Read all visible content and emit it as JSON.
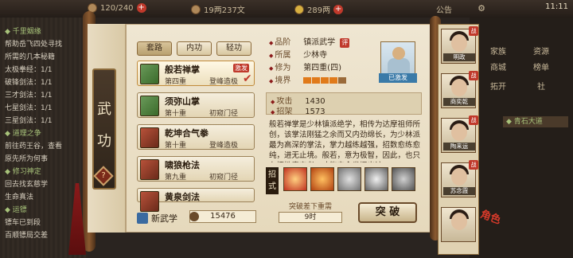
{
  "topbar": {
    "stamina": "120/240",
    "silver": "19两237文",
    "gold": "289两",
    "notice": "公告",
    "time": "11:11"
  },
  "left_quests": [
    {
      "text": "◆ 千里姻缘",
      "color": "green"
    },
    {
      "text": "帮助岳飞四处寻找",
      "color": "white"
    },
    {
      "text": "所需的几本秘籍",
      "color": "white"
    },
    {
      "text": "太极拳经：1/1",
      "color": "white"
    },
    {
      "text": "破锋剑法：1/1",
      "color": "white"
    },
    {
      "text": "三才剑法：1/1",
      "color": "white"
    },
    {
      "text": "七星剑法：1/1",
      "color": "white"
    },
    {
      "text": "三星剑法：1/1",
      "color": "white"
    },
    {
      "text": "◆ 道理之争",
      "color": "green"
    },
    {
      "text": "前往药王谷，查看",
      "color": "white"
    },
    {
      "text": "原先所为何事",
      "color": "white"
    },
    {
      "text": "◆ 修习神定",
      "color": "green"
    },
    {
      "text": "回去找玄慈学",
      "color": "white"
    },
    {
      "text": "生命真法",
      "color": "white"
    },
    {
      "text": "◆ 运镖",
      "color": "green"
    },
    {
      "text": "镖车已到段",
      "color": "white"
    },
    {
      "text": "百顺镖局交差",
      "color": "white"
    }
  ],
  "panel": {
    "title": "武功",
    "help": "?",
    "tabs": [
      "套路",
      "内功",
      "轻功"
    ],
    "skills": [
      {
        "name": "般若禅掌",
        "tier": "第四重",
        "level": "登峰造极",
        "book": "green",
        "badge": "激发",
        "selected": true
      },
      {
        "name": "须弥山掌",
        "tier": "第十重",
        "level": "初窥门径",
        "book": "green"
      },
      {
        "name": "乾坤合气拳",
        "tier": "第十重",
        "level": "登峰造极",
        "book": "red"
      },
      {
        "name": "啸狼枪法",
        "tier": "第九重",
        "level": "初窥门径",
        "book": "red"
      },
      {
        "name": "黄泉剑法",
        "tier": "",
        "level": "",
        "book": "red"
      }
    ],
    "new_skill_label": "新武学",
    "points": "15476"
  },
  "detail": {
    "rank_key": "品阶",
    "rank_val": "镇派武学",
    "rank_badge": "评",
    "sect_key": "所属",
    "sect_val": "少林寺",
    "cult_key": "修为",
    "cult_val": "第四重(四)",
    "realm_key": "境界",
    "realm_filled": 4,
    "realm_total": 5,
    "avatar_label": "已激发",
    "atk_key": "攻击",
    "atk_val": "1430",
    "parry_key": "招架",
    "parry_val": "1573",
    "desc": "般若禅掌是少林镇派绝学，相传为达摩祖师所创，该掌法刚猛之余而又内劲绵长，为少林派最为高深的掌法，掌力越练越强，招数愈练愈纯，进无止境。般若，意为极智，因此，也只有悟性奇高者，才能完全发挥出该",
    "moves_label": "招式",
    "cond_label": "突破差下重需",
    "cond_val": "9时",
    "break_label": "突 破"
  },
  "characters": [
    {
      "name": "明政",
      "battle": "战"
    },
    {
      "name": "商奕乾",
      "battle": "战"
    },
    {
      "name": "陶来运",
      "battle": "战"
    },
    {
      "name": "苏念霞",
      "battle": "战"
    },
    {
      "name": "",
      "battle": ""
    }
  ],
  "side_menu": {
    "items": [
      "家族",
      "商城",
      "拓开"
    ],
    "items_right": [
      "资源",
      "榜单",
      "社"
    ],
    "quest_tab": "◆ 青石大道"
  },
  "corner_text": "角色"
}
